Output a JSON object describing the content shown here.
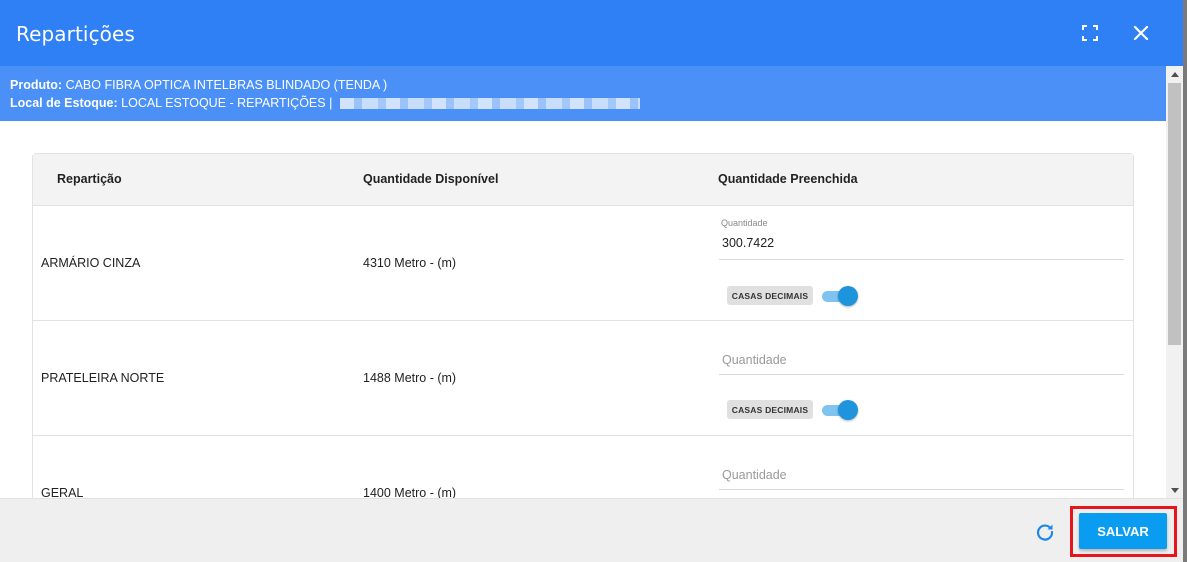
{
  "dialog": {
    "title": "Repartições"
  },
  "info": {
    "product_label": "Produto:",
    "product_value": "CABO FIBRA OPTICA INTELBRAS BLINDADO (TENDA )",
    "location_label": "Local de Estoque:",
    "location_value": "LOCAL ESTOQUE - REPARTIÇÕES |"
  },
  "table": {
    "headers": {
      "partition": "Repartição",
      "available": "Quantidade Disponível",
      "filled": "Quantidade Preenchida"
    },
    "rows": [
      {
        "name": "ARMÁRIO CINZA",
        "available": "4310 Metro - (m)",
        "field_label": "Quantidade",
        "value": "300.7422",
        "chip": "CASAS DECIMAIS"
      },
      {
        "name": "PRATELEIRA NORTE",
        "available": "1488 Metro - (m)",
        "placeholder": "Quantidade",
        "chip": "CASAS DECIMAIS"
      },
      {
        "name": "GERAL",
        "available": "1400 Metro - (m)",
        "placeholder": "Quantidade"
      }
    ]
  },
  "footer": {
    "save_label": "SALVAR"
  },
  "icons": {
    "fullscreen": "fullscreen-icon",
    "close": "close-icon",
    "refresh": "refresh-icon"
  },
  "colors": {
    "header": "#2f7ff5",
    "info_bar": "#4a90f7",
    "save_button": "#0a9cf0",
    "highlight": "#e8141c",
    "toggle": "#1e94dd"
  }
}
